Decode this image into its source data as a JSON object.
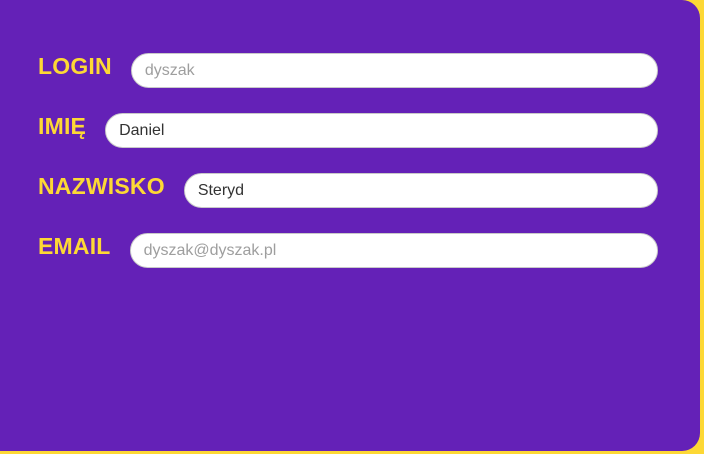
{
  "colors": {
    "background": "#fdd835",
    "panel": "#6421b7",
    "label": "#fdd835"
  },
  "form": {
    "login": {
      "label": "LOGIN",
      "value": "",
      "placeholder": "dyszak"
    },
    "imie": {
      "label": "IMIĘ",
      "value": "Daniel",
      "placeholder": ""
    },
    "nazwisko": {
      "label": "NAZWISKO",
      "value": "Steryd",
      "placeholder": ""
    },
    "email": {
      "label": "EMAIL",
      "value": "",
      "placeholder": "dyszak@dyszak.pl"
    }
  }
}
